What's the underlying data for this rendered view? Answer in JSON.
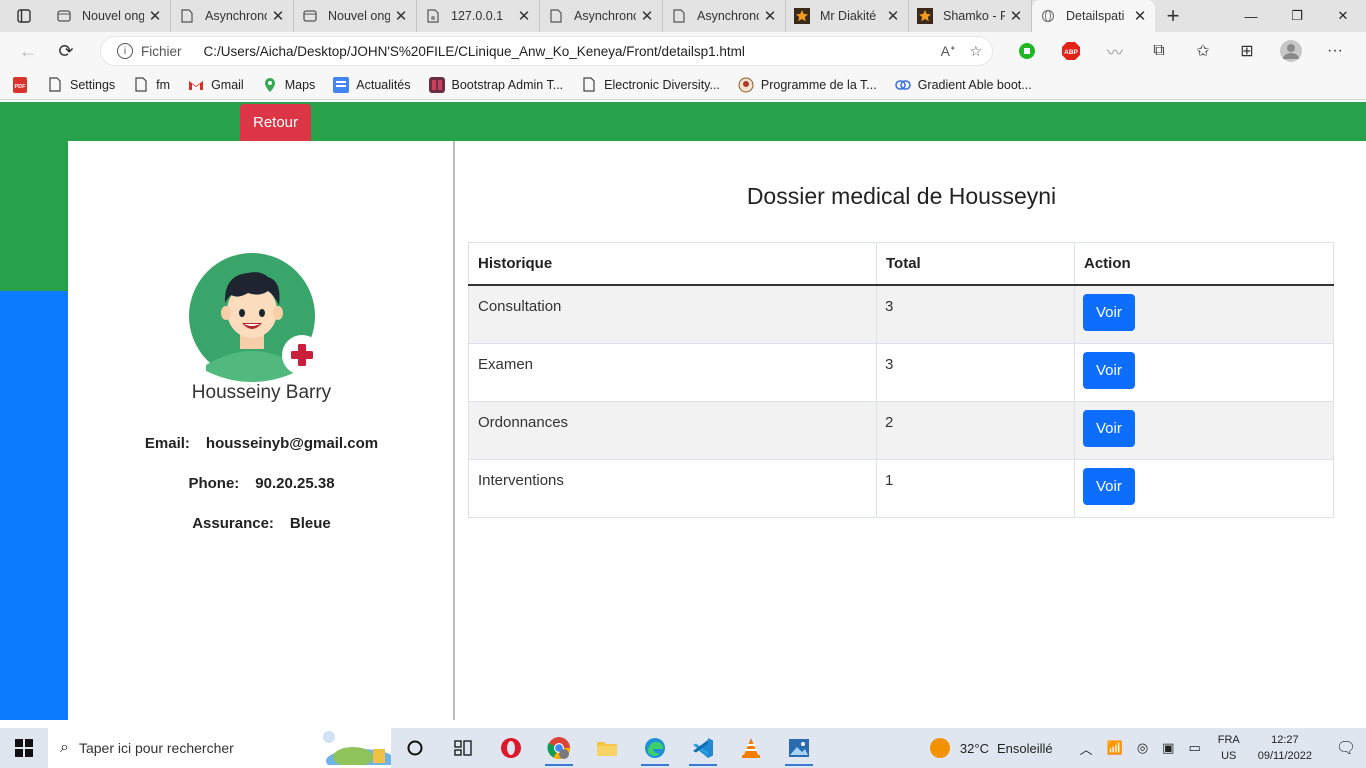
{
  "browser": {
    "tabs": [
      {
        "label": "Nouvel onglet",
        "icon": "page-icon"
      },
      {
        "label": "Asynchronous",
        "icon": "doc-icon"
      },
      {
        "label": "Nouvel onglet",
        "icon": "page-icon"
      },
      {
        "label": "127.0.0.1",
        "icon": "doc-icon"
      },
      {
        "label": "Asynchronous",
        "icon": "doc-icon"
      },
      {
        "label": "Asynchronous",
        "icon": "doc-icon"
      },
      {
        "label": "Mr Diakité",
        "icon": "star-icon"
      },
      {
        "label": "Shamko - Fi",
        "icon": "star-icon"
      },
      {
        "label": "Detailspati",
        "icon": "globe-icon",
        "active": true
      }
    ],
    "address": {
      "scheme_label": "Fichier",
      "url": "C:/Users/Aicha/Desktop/JOHN'S%20FILE/CLinique_Anw_Ko_Keneya/Front/detailsp1.html"
    },
    "bookmarks": [
      {
        "label": "Settings",
        "icon": "doc-icon"
      },
      {
        "label": "fm",
        "icon": "doc-icon"
      },
      {
        "label": "Gmail",
        "icon": "gmail-icon"
      },
      {
        "label": "Maps",
        "icon": "maps-icon"
      },
      {
        "label": "Actualités",
        "icon": "news-icon"
      },
      {
        "label": "Bootstrap Admin T...",
        "icon": "bootstrap-icon"
      },
      {
        "label": "Electronic Diversity...",
        "icon": "doc-icon"
      },
      {
        "label": "Programme de la T...",
        "icon": "programme-icon"
      },
      {
        "label": "Gradient Able boot...",
        "icon": "link-icon"
      }
    ]
  },
  "page": {
    "back_button": "Retour",
    "patient": {
      "name": "Housseiny Barry",
      "email_label": "Email:",
      "email": "housseinyb@gmail.com",
      "phone_label": "Phone:",
      "phone": "90.20.25.38",
      "insurance_label": "Assurance:",
      "insurance": "Bleue"
    },
    "title": "Dossier medical de Housseyni",
    "table": {
      "headers": [
        "Historique",
        "Total",
        "Action"
      ],
      "rows": [
        {
          "historique": "Consultation",
          "total": "3",
          "action": "Voir"
        },
        {
          "historique": "Examen",
          "total": "3",
          "action": "Voir"
        },
        {
          "historique": "Ordonnances",
          "total": "2",
          "action": "Voir"
        },
        {
          "historique": "Interventions",
          "total": "1",
          "action": "Voir"
        }
      ]
    },
    "colors": {
      "header_green": "#28a14b",
      "sidebar_blue": "#0d7bfd",
      "retour_red": "#dc3545",
      "voir_blue": "#0d6efd"
    }
  },
  "taskbar": {
    "search_placeholder": "Taper ici pour rechercher",
    "weather_temp": "32°C",
    "weather_desc": "Ensoleillé",
    "lang_1": "FRA",
    "lang_2": "US",
    "time": "12:27",
    "date": "09/11/2022"
  }
}
